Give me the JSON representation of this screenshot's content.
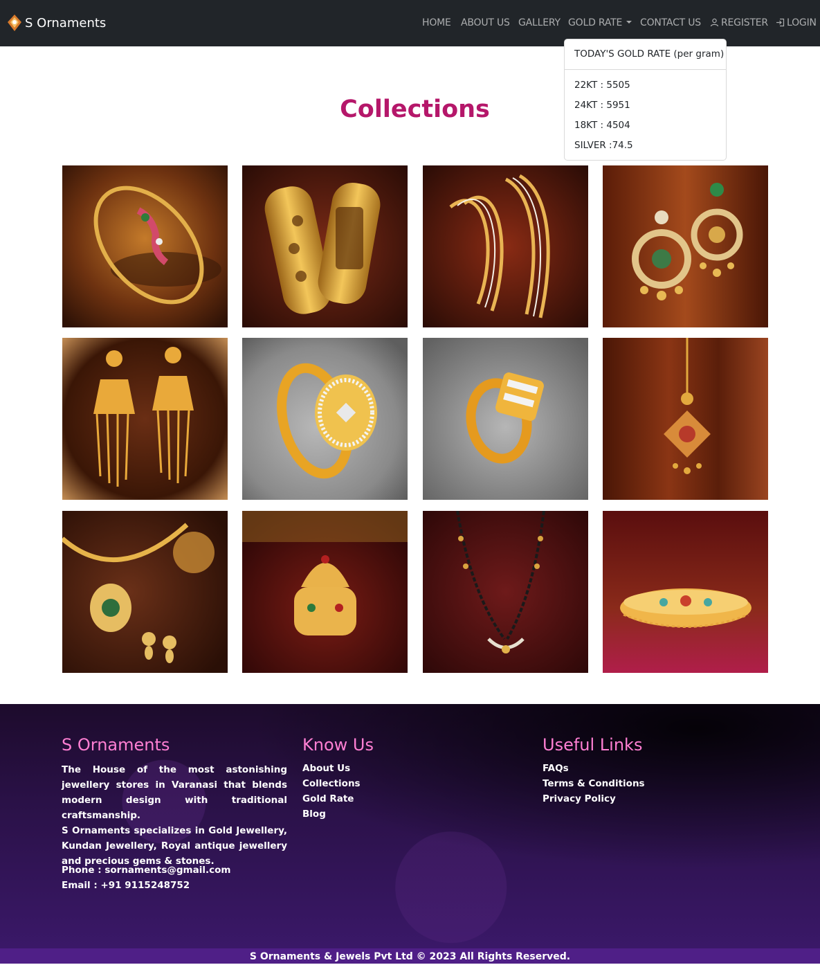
{
  "navbar": {
    "brand": "S Ornaments",
    "links": {
      "home": "HOME",
      "about": "ABOUT US",
      "gallery": "GALLERY",
      "gold_rate": "GOLD RATE",
      "contact": "CONTACT US",
      "register": "REGISTER",
      "login": "LOGIN"
    }
  },
  "gold_rate_dropdown": {
    "header": "TODAY'S GOLD RATE (per gram)",
    "items": [
      "22KT : 5505",
      "24KT : 5951",
      "18KT : 4504",
      "SILVER :74.5"
    ]
  },
  "main": {
    "title": "Collections",
    "images": [
      "bangle-icon",
      "kada-pair-icon",
      "wave-bangles-icon",
      "chandbali-earrings-icon",
      "jhumka-earrings-icon",
      "diamond-ring-icon",
      "gold-ring-icon",
      "pendant-icon",
      "necklace-set-icon",
      "kumkum-box-icon",
      "mangalsutra-icon",
      "vanki-armlet-icon"
    ]
  },
  "footer": {
    "col1": {
      "heading": "S Ornaments",
      "para1": "The House of the most astonishing jewellery stores in Varanasi that blends modern design with traditional craftsmanship.",
      "para2": "S Ornaments specializes in Gold Jewellery, Kundan Jewellery, Royal antique jewellery and precious gems & stones.",
      "phone": "Phone : sornaments@gmail.com",
      "email": "Email : +91 9115248752"
    },
    "col2": {
      "heading": "Know Us",
      "links": [
        "About Us",
        "Collections",
        "Gold Rate",
        "Blog"
      ]
    },
    "col3": {
      "heading": "Useful Links",
      "links": [
        "FAQs",
        "Terms & Conditions",
        "Privacy Policy"
      ]
    },
    "copyright": "S Ornaments & Jewels Pvt Ltd © 2023 All Rights Reserved."
  },
  "colors": {
    "navbar_bg": "#212529",
    "title_accent": "#b5176a",
    "footer_heading": "#ff7fd3",
    "bottom_bar": "#4f1f87"
  }
}
